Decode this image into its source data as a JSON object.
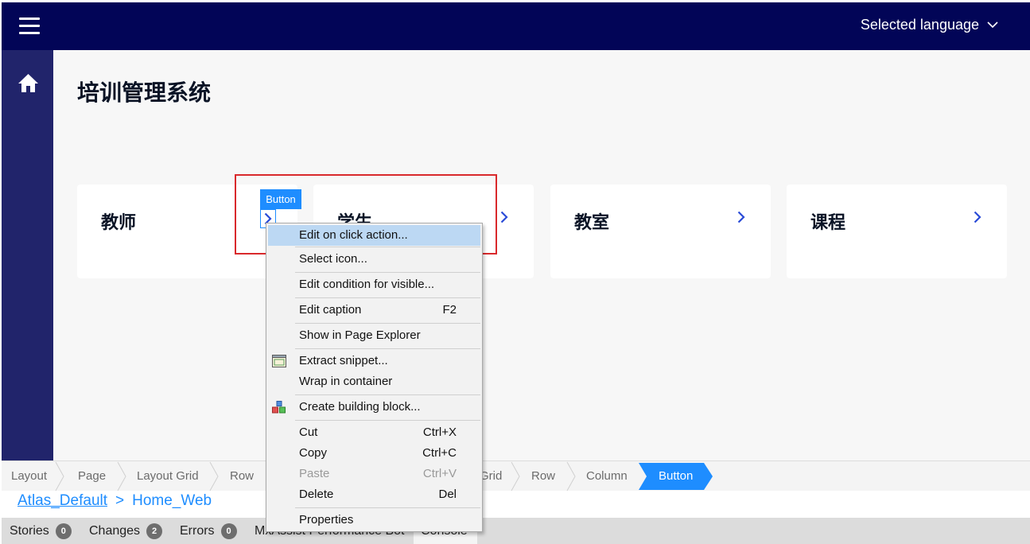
{
  "topbar": {
    "language_label": "Selected language"
  },
  "page": {
    "title": "培训管理系统"
  },
  "cards": [
    {
      "label": "教师"
    },
    {
      "label": "学生"
    },
    {
      "label": "教室"
    },
    {
      "label": "课程"
    }
  ],
  "selection": {
    "tag": "Button"
  },
  "context_menu": {
    "items": [
      {
        "label": "Edit on click action...",
        "shortcut": "",
        "highlighted": true
      },
      {
        "label": "Select icon...",
        "shortcut": ""
      },
      {
        "label": "Edit condition for visible...",
        "shortcut": ""
      },
      {
        "label": "Edit caption",
        "shortcut": "F2"
      },
      {
        "label": "Show in Page Explorer",
        "shortcut": ""
      },
      {
        "label": "Extract snippet...",
        "shortcut": "",
        "icon": "snippet-icon"
      },
      {
        "label": "Wrap in container",
        "shortcut": ""
      },
      {
        "label": "Create building block...",
        "shortcut": "",
        "icon": "building-block-icon"
      },
      {
        "label": "Cut",
        "shortcut": "Ctrl+X"
      },
      {
        "label": "Copy",
        "shortcut": "Ctrl+C"
      },
      {
        "label": "Paste",
        "shortcut": "Ctrl+V",
        "disabled": true
      },
      {
        "label": "Delete",
        "shortcut": "Del"
      },
      {
        "label": "Properties",
        "shortcut": ""
      }
    ]
  },
  "breadcrumb": {
    "items": [
      "Layout",
      "Page",
      "Layout Grid",
      "Row",
      "Grid",
      "Row",
      "Column",
      "Button"
    ],
    "active": "Button"
  },
  "path": {
    "layout": "Atlas_Default",
    "separator": ">",
    "page": "Home_Web"
  },
  "bottom_tabs": [
    {
      "label": "Stories",
      "count": "0"
    },
    {
      "label": "Changes",
      "count": "2"
    },
    {
      "label": "Errors",
      "count": "0"
    },
    {
      "label": "MxAssist Performance Bot"
    },
    {
      "label": "Console",
      "active": true
    }
  ],
  "colors": {
    "topbar": "#020557",
    "sidebar": "#21246b",
    "accent": "#1e8dff",
    "selection_border": "#d9292c",
    "chevron": "#2a4bd7"
  }
}
